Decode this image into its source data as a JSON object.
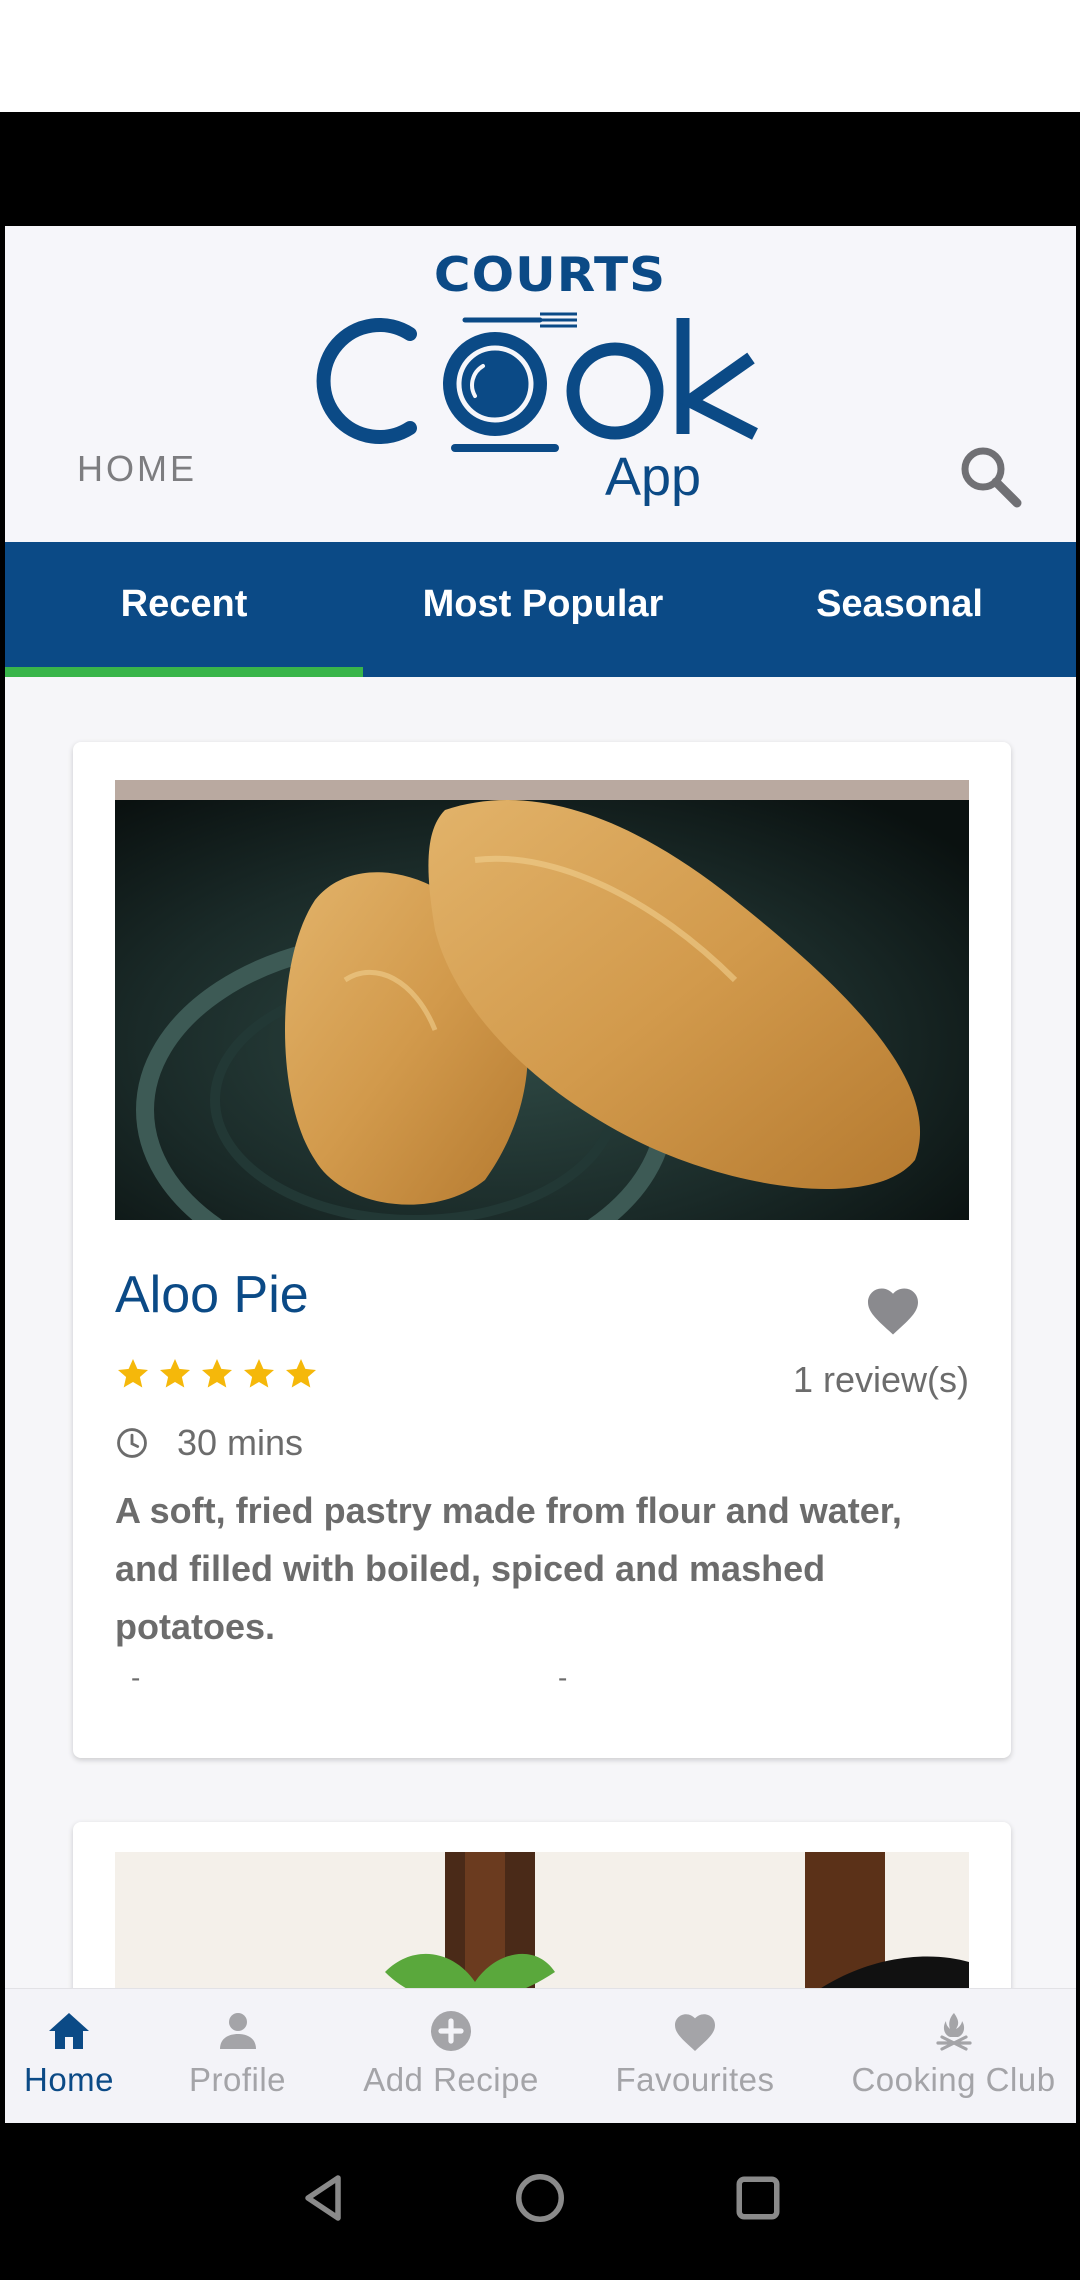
{
  "header": {
    "logo_brand": "COURTS",
    "logo_word": "Cook",
    "logo_sub": "App",
    "home_label": "HOME",
    "search_icon": "search-icon"
  },
  "tabs": [
    {
      "label": "Recent",
      "active": true
    },
    {
      "label": "Most Popular",
      "active": false
    },
    {
      "label": "Seasonal",
      "active": false
    }
  ],
  "recipe": {
    "title": "Aloo Pie",
    "rating": 5,
    "rating_max": 5,
    "reviews": "1 review(s)",
    "time": "30 mins",
    "description": "A soft, fried pastry made from flour and water, and filled with boiled, spiced and mashed potatoes.",
    "dash_left": "-",
    "dash_right": "-",
    "favorited": false
  },
  "bottom_nav": [
    {
      "label": "Home",
      "icon": "home-icon",
      "active": true
    },
    {
      "label": "Profile",
      "icon": "person-icon",
      "active": false
    },
    {
      "label": "Add Recipe",
      "icon": "add-circle-icon",
      "active": false
    },
    {
      "label": "Favourites",
      "icon": "heart-icon",
      "active": false
    },
    {
      "label": "Cooking Club",
      "icon": "cooking-club-icon",
      "active": false
    }
  ],
  "colors": {
    "brand_blue": "#0b4a86",
    "tab_indicator": "#39b54a",
    "star": "#f5b80a",
    "muted_text": "#6c6c6c"
  }
}
